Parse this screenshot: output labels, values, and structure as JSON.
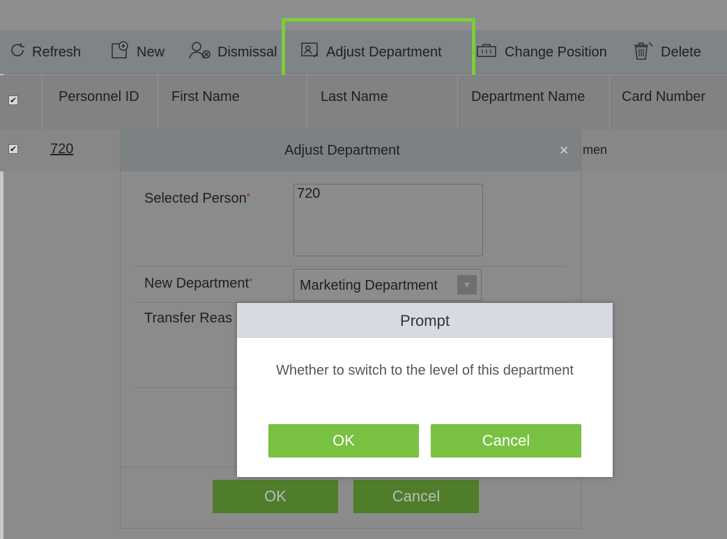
{
  "toolbar": {
    "items": [
      {
        "label": "Refresh",
        "icon": "refresh-icon"
      },
      {
        "label": "New",
        "icon": "add-icon"
      },
      {
        "label": "Dismissal",
        "icon": "dismiss-user-icon"
      },
      {
        "label": "Adjust Department",
        "icon": "adjust-department-icon"
      },
      {
        "label": "Change Position",
        "icon": "change-position-icon"
      },
      {
        "label": "Delete",
        "icon": "delete-icon"
      }
    ],
    "highlight_color": "#7ccd3a"
  },
  "table": {
    "headers": [
      "Personnel ID",
      "First Name",
      "Last Name",
      "Department Name",
      "Card Number"
    ],
    "rows": [
      {
        "personnel_id": "720",
        "department_partial": "men",
        "checked": true
      }
    ]
  },
  "adjust_dialog": {
    "title": "Adjust Department",
    "close": "×",
    "selected_person_label": "Selected Person",
    "selected_person_value": "720",
    "new_department_label": "New Department",
    "new_department_value": "Marketing Department",
    "transfer_reason_label": "Transfer Reas",
    "required_mark": "*",
    "ok_label": "OK",
    "cancel_label": "Cancel"
  },
  "prompt": {
    "title": "Prompt",
    "message": "Whether to switch to the level of this department",
    "ok_label": "OK",
    "cancel_label": "Cancel",
    "button_color": "#79c141"
  }
}
